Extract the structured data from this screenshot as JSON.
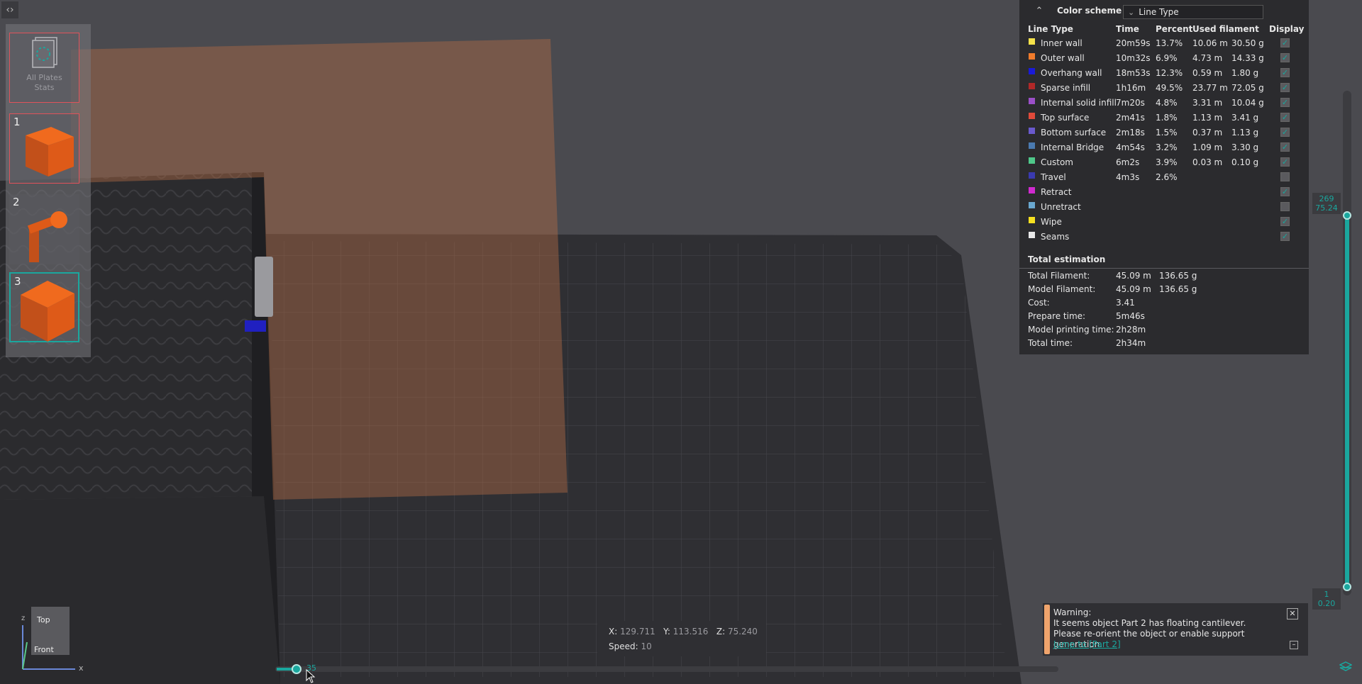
{
  "plates": {
    "all_label": "All Plates\nStats",
    "items": [
      {
        "number": "1"
      },
      {
        "number": "2"
      },
      {
        "number": "3"
      }
    ]
  },
  "stats": {
    "color_scheme_label": "Color scheme",
    "color_scheme_value": "Line Type",
    "columns": [
      "Line Type",
      "Time",
      "Percent",
      "Used filament",
      "Display"
    ],
    "rows": [
      {
        "name": "Inner wall",
        "color": "#f5e24a",
        "time": "20m59s",
        "percent": "13.7%",
        "length": "10.06 m",
        "weight": "30.50 g",
        "display": true
      },
      {
        "name": "Outer wall",
        "color": "#f07b2b",
        "time": "10m32s",
        "percent": "6.9%",
        "length": "4.73 m",
        "weight": "14.33 g",
        "display": true
      },
      {
        "name": "Overhang wall",
        "color": "#1a1ad8",
        "time": "18m53s",
        "percent": "12.3%",
        "length": "0.59 m",
        "weight": "1.80 g",
        "display": true
      },
      {
        "name": "Sparse infill",
        "color": "#b02828",
        "time": "1h16m",
        "percent": "49.5%",
        "length": "23.77 m",
        "weight": "72.05 g",
        "display": true
      },
      {
        "name": "Internal solid infill",
        "color": "#9b4fc8",
        "time": "7m20s",
        "percent": "4.8%",
        "length": "3.31 m",
        "weight": "10.04 g",
        "display": true
      },
      {
        "name": "Top surface",
        "color": "#e04a3a",
        "time": "2m41s",
        "percent": "1.8%",
        "length": "1.13 m",
        "weight": "3.41 g",
        "display": true
      },
      {
        "name": "Bottom surface",
        "color": "#6a5acd",
        "time": "2m18s",
        "percent": "1.5%",
        "length": "0.37 m",
        "weight": "1.13 g",
        "display": true
      },
      {
        "name": "Internal Bridge",
        "color": "#4a7ab0",
        "time": "4m54s",
        "percent": "3.2%",
        "length": "1.09 m",
        "weight": "3.30 g",
        "display": true
      },
      {
        "name": "Custom",
        "color": "#4fc88a",
        "time": "6m2s",
        "percent": "3.9%",
        "length": "0.03 m",
        "weight": "0.10 g",
        "display": true
      },
      {
        "name": "Travel",
        "color": "#3a3ab0",
        "time": "4m3s",
        "percent": "2.6%",
        "length": "",
        "weight": "",
        "display": false
      },
      {
        "name": "Retract",
        "color": "#d02ad0",
        "time": "",
        "percent": "",
        "length": "",
        "weight": "",
        "display": true
      },
      {
        "name": "Unretract",
        "color": "#6aa8d0",
        "time": "",
        "percent": "",
        "length": "",
        "weight": "",
        "display": false
      },
      {
        "name": "Wipe",
        "color": "#f5e020",
        "time": "",
        "percent": "",
        "length": "",
        "weight": "",
        "display": true
      },
      {
        "name": "Seams",
        "color": "#e8e8e8",
        "time": "",
        "percent": "",
        "length": "",
        "weight": "",
        "display": true
      }
    ],
    "total_title": "Total estimation",
    "totals": [
      {
        "label": "Total Filament:",
        "v1": "45.09 m",
        "v2": "136.65 g"
      },
      {
        "label": "Model Filament:",
        "v1": "45.09 m",
        "v2": "136.65 g"
      },
      {
        "label": "Cost:",
        "v1": "3.41",
        "v2": ""
      },
      {
        "label": "Prepare time:",
        "v1": "5m46s",
        "v2": ""
      },
      {
        "label": "Model printing time:",
        "v1": "2h28m",
        "v2": ""
      },
      {
        "label": "Total time:",
        "v1": "2h34m",
        "v2": ""
      }
    ]
  },
  "layer_slider": {
    "top_layer": "269",
    "top_height": "75.24",
    "bottom_layer": "1",
    "bottom_height": "0.20"
  },
  "move_slider": {
    "value": "35"
  },
  "position": {
    "x_label": "X:",
    "x": "129.711",
    "y_label": "Y:",
    "y": "113.516",
    "z_label": "Z:",
    "z": "75.240",
    "speed_label": "Speed:",
    "speed": "10"
  },
  "warning": {
    "title": "Warning:",
    "message": "It seems object Part 2 has floating cantilever. Please re-orient the object or enable support generation.",
    "link": "Jump to [Part 2]"
  },
  "nav_cube": {
    "top": "Top",
    "front": "Front",
    "axis_x": "x",
    "axis_z": "z"
  },
  "colors": {
    "accent": "#1aa79e",
    "plate_bed": "#2e2e32",
    "model": "#6b4a3c",
    "warning": "#f0a46c"
  }
}
